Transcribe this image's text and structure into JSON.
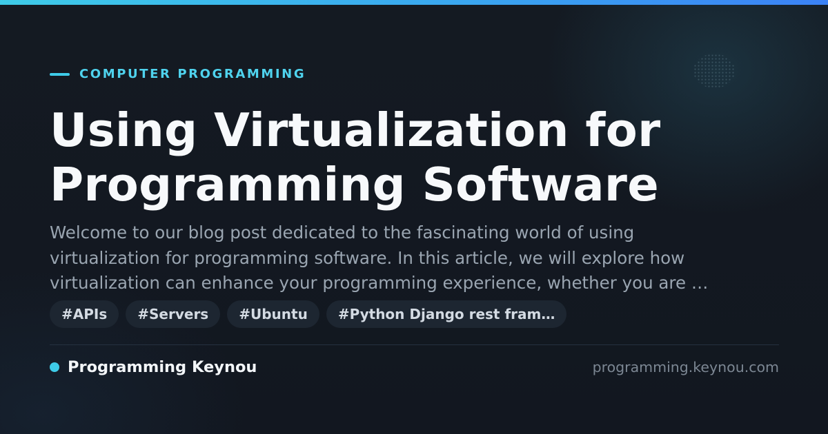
{
  "category": "COMPUTER PROGRAMMING",
  "title_lines": [
    "Using Virtualization for",
    "Programming Software"
  ],
  "excerpt_lines": [
    "Welcome to our blog post dedicated to the fascinating world of using",
    "virtualization for programming software. In this article, we will explore how",
    "virtualization can enhance your programming experience, whether you are …"
  ],
  "tags": [
    "#APIs",
    "#Servers",
    "#Ubuntu",
    "#Python Django rest fram…"
  ],
  "footer": {
    "brand_name": "Programming Keynou",
    "site_url": "programming.keynou.com"
  },
  "colors": {
    "accent": "#3ecbe8",
    "background": "#121720",
    "title": "#f7f9fb",
    "excerpt": "#9aa5b1"
  }
}
